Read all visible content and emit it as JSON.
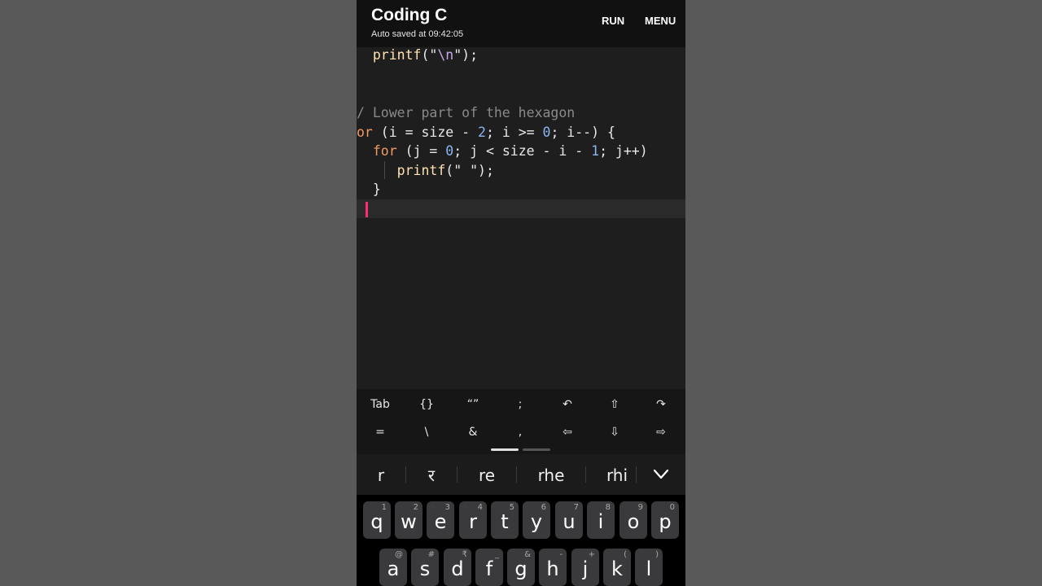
{
  "app": {
    "title": "Coding C",
    "autosave": "Auto saved at 09:42:05",
    "run_label": "RUN",
    "menu_label": "MENU"
  },
  "editor": {
    "line1": {
      "indent": "  ",
      "fn": "printf",
      "open": "(\"",
      "esc": "\\n",
      "close": "\");"
    },
    "comment": "/ Lower part of the hexagon",
    "line_for_outer": {
      "kw": "or",
      "p1": " (i = size - ",
      "n1": "2",
      "p2": "; i >= ",
      "n2": "0",
      "p3": "; i--) {"
    },
    "line_for_inner": {
      "indent": "  ",
      "kw": "for",
      "p1": " (j = ",
      "n1": "0",
      "p2": "; j < size - i - ",
      "n2": "1",
      "p3": "; j++)"
    },
    "line_printf": {
      "indent": "     ",
      "fn": "printf",
      "open": "(\"",
      "str": " ",
      "close": "\");"
    },
    "line_brace": {
      "text": "  }"
    }
  },
  "symbol_bar": {
    "row1": [
      "Tab",
      "{}",
      "“”",
      ";",
      "↶",
      "⇧",
      "↷"
    ],
    "row2": [
      "=",
      "\\",
      "&",
      ",",
      "⇦",
      "⇩",
      "⇨"
    ],
    "icons_row1": [
      "tab-key",
      "braces-key",
      "quotes-key",
      "semicolon-key",
      "undo-icon",
      "shift-up-icon",
      "redo-icon"
    ],
    "icons_row2": [
      "equals-key",
      "backslash-key",
      "ampersand-key",
      "comma-key",
      "arrow-left-icon",
      "arrow-down-icon",
      "arrow-right-icon"
    ]
  },
  "suggestions": {
    "items": [
      "r",
      "र",
      "re",
      "rhe",
      "rhi"
    ],
    "collapse_icon": "chevron-down-icon"
  },
  "keyboard": {
    "row1": [
      {
        "key": "q",
        "hint": "1"
      },
      {
        "key": "w",
        "hint": "2"
      },
      {
        "key": "e",
        "hint": "3"
      },
      {
        "key": "r",
        "hint": "4"
      },
      {
        "key": "t",
        "hint": "5"
      },
      {
        "key": "y",
        "hint": "6"
      },
      {
        "key": "u",
        "hint": "7"
      },
      {
        "key": "i",
        "hint": "8"
      },
      {
        "key": "o",
        "hint": "9"
      },
      {
        "key": "p",
        "hint": "0"
      }
    ],
    "row2": [
      {
        "key": "a",
        "hint": "@"
      },
      {
        "key": "s",
        "hint": "#"
      },
      {
        "key": "d",
        "hint": "₹"
      },
      {
        "key": "f",
        "hint": "_"
      },
      {
        "key": "g",
        "hint": "&"
      },
      {
        "key": "h",
        "hint": "-"
      },
      {
        "key": "j",
        "hint": "+"
      },
      {
        "key": "k",
        "hint": "("
      },
      {
        "key": "l",
        "hint": ")"
      }
    ]
  },
  "colors": {
    "cursor": "#ff2d6f",
    "keyword": "#f39a62",
    "number": "#8cb4f2",
    "string": "#b7d7a0",
    "function": "#ffe2b0",
    "comment": "#8a8a8a"
  }
}
